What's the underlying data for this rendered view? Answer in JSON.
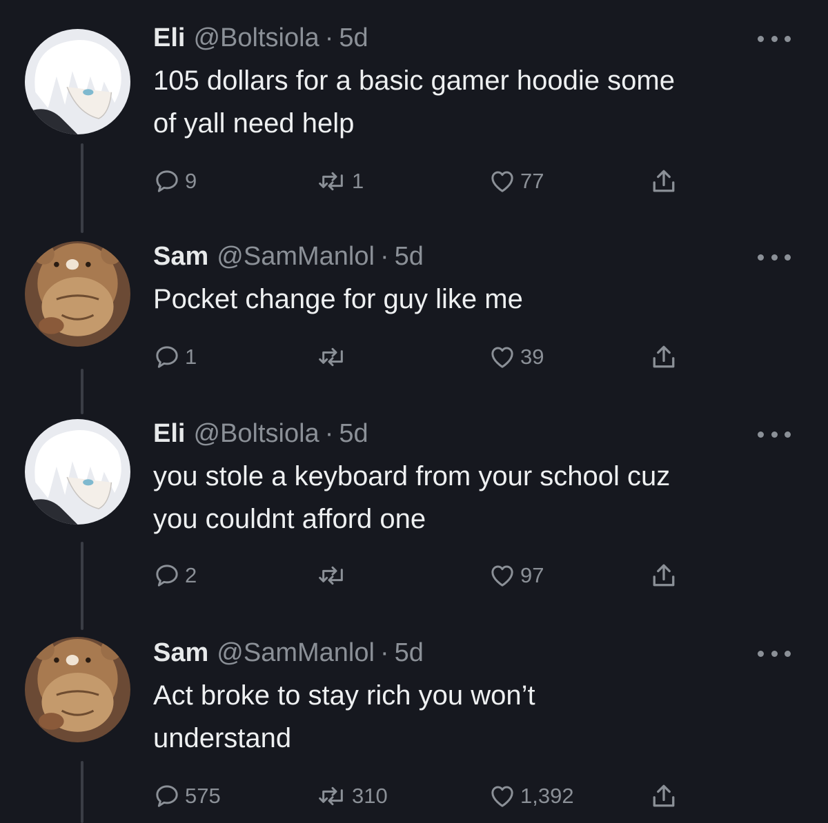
{
  "tweets": [
    {
      "name": "Eli",
      "handle": "@Boltsiola",
      "separator": "·",
      "time": "5d",
      "text_lines": [
        "105 dollars for a basic gamer hoodie some",
        "of yall need help"
      ],
      "replies": "9",
      "retweets": "1",
      "likes": "77",
      "avatar": "anime-character-avatar"
    },
    {
      "name": "Sam",
      "handle": "@SamManlol",
      "separator": "·",
      "time": "5d",
      "text_lines": [
        "Pocket change for guy like me"
      ],
      "replies": "1",
      "retweets": "",
      "likes": "39",
      "avatar": "bear-hat-cat-avatar"
    },
    {
      "name": "Eli",
      "handle": "@Boltsiola",
      "separator": "·",
      "time": "5d",
      "text_lines": [
        "you stole a keyboard from your school cuz",
        "you couldnt afford one"
      ],
      "replies": "2",
      "retweets": "",
      "likes": "97",
      "avatar": "anime-character-avatar"
    },
    {
      "name": "Sam",
      "handle": "@SamManlol",
      "separator": "·",
      "time": "5d",
      "text_lines": [
        "Act broke to stay rich you won’t",
        "understand"
      ],
      "replies": "575",
      "retweets": "310",
      "likes": "1,392",
      "avatar": "bear-hat-cat-avatar"
    }
  ],
  "colors": {
    "background": "#16181f",
    "primary_text": "#e7e9ea",
    "secondary_text": "#8b9097",
    "thread_line": "#3a3d45"
  },
  "icons": [
    "reply-icon",
    "retweet-icon",
    "like-icon",
    "share-icon",
    "more-icon"
  ]
}
